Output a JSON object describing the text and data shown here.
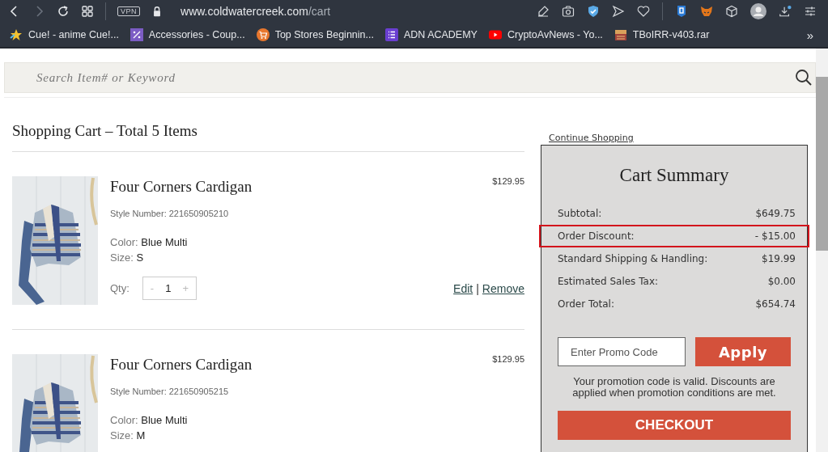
{
  "browser": {
    "url_host": "www.coldwatercreek.com",
    "url_path": "/cart",
    "vpn_label": "VPN",
    "bookmarks": [
      {
        "kind": "star",
        "label": "Cue! - anime Cue!..."
      },
      {
        "kind": "percent",
        "label": "Accessories - Coup..."
      },
      {
        "kind": "cart",
        "label": "Top Stores Beginnin..."
      },
      {
        "kind": "list",
        "label": "ADN ACADEMY"
      },
      {
        "kind": "video",
        "label": "CryptoAvNews - Yo..."
      },
      {
        "kind": "box",
        "label": "TBoIRR-v403.rar"
      }
    ],
    "more": "»"
  },
  "search": {
    "placeholder": "Search Item# or Keyword"
  },
  "cart": {
    "title": "Shopping Cart – Total 5 Items",
    "items": [
      {
        "name": "Four Corners Cardigan",
        "price": "$129.95",
        "style_label": "Style Number:",
        "style": "221650905210",
        "color_label": "Color:",
        "color_value": "Blue Multi",
        "size_label": "Size:",
        "size_value": "S",
        "qty_label": "Qty:",
        "qty": "1",
        "minus": "-",
        "plus": "+",
        "edit": "Edit",
        "sep": "|",
        "remove": "Remove"
      },
      {
        "name": "Four Corners Cardigan",
        "price": "$129.95",
        "style_label": "Style Number:",
        "style": "221650905215",
        "color_label": "Color:",
        "color_value": "Blue Multi",
        "size_label": "Size:",
        "size_value": "M"
      }
    ]
  },
  "summary": {
    "continue": "Continue Shopping",
    "title": "Cart Summary",
    "rows": [
      {
        "label": "Subtotal:",
        "value": "$649.75",
        "highlighted": false
      },
      {
        "label": "Order Discount:",
        "value": "- $15.00",
        "highlighted": true
      },
      {
        "label": "Standard Shipping & Handling:",
        "value": "$19.99",
        "highlighted": false
      },
      {
        "label": "Estimated Sales Tax:",
        "value": "$0.00",
        "highlighted": false
      },
      {
        "label": "Order Total:",
        "value": "$654.74",
        "highlighted": false
      }
    ],
    "promo_placeholder": "Enter Promo Code",
    "apply": "Apply",
    "message": "Your promotion code is valid. Discounts are applied when promotion conditions are met.",
    "checkout": "CHECKOUT"
  }
}
